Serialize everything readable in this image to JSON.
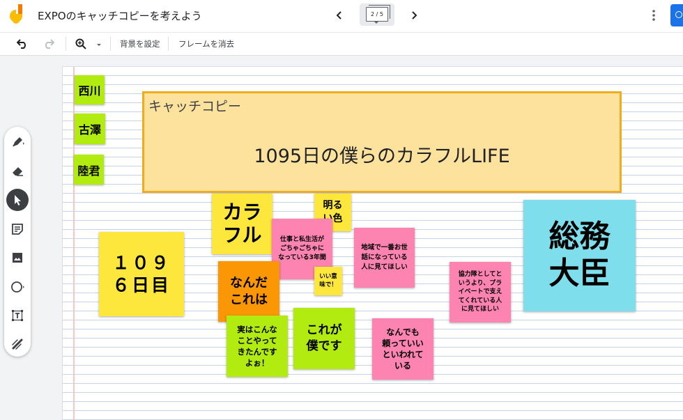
{
  "header": {
    "title": "EXPOのキャッチコピーを考えよう",
    "prev_icon": "chevron-left-icon",
    "next_icon": "chevron-right-icon",
    "frame_counter": "2 / 5",
    "more_icon": "more-vert-icon",
    "share_icon": "person-add-icon"
  },
  "toolbar": {
    "undo_icon": "undo-icon",
    "redo_icon": "redo-icon",
    "zoom_icon": "zoom-icon",
    "set_background_label": "背景を設定",
    "clear_frame_label": "フレームを消去"
  },
  "tools": [
    {
      "name": "pen",
      "icon": "pen-icon"
    },
    {
      "name": "eraser",
      "icon": "eraser-icon"
    },
    {
      "name": "select",
      "icon": "cursor-icon",
      "active": true
    },
    {
      "name": "sticky-note",
      "icon": "sticky-note-icon"
    },
    {
      "name": "image",
      "icon": "image-icon"
    },
    {
      "name": "shape",
      "icon": "circle-icon"
    },
    {
      "name": "text-box",
      "icon": "text-box-icon"
    },
    {
      "name": "laser",
      "icon": "laser-icon"
    }
  ],
  "frame": {
    "label": "キャッチコピー",
    "main_text": "1095日の僕らのカラフルLIFE"
  },
  "notes": [
    {
      "id": "nishikawa",
      "text": "西川",
      "color": "#b2eb10"
    },
    {
      "id": "furusawa",
      "text": "古澤",
      "color": "#b2eb10"
    },
    {
      "id": "rikukun",
      "text": "陸君",
      "color": "#b2eb10"
    },
    {
      "id": "colorful",
      "text": "カラ\nフル",
      "color": "#fde73d"
    },
    {
      "id": "bright",
      "text": "明る\nい色",
      "color": "#fde73d"
    },
    {
      "id": "work-life",
      "text": "仕事と私生活が\nごちゃごちゃに\nなっている3年間",
      "color": "#fd83b0"
    },
    {
      "id": "local",
      "text": "地域で一番お世\n話になっている\n人に見てほしい",
      "color": "#fd83b0"
    },
    {
      "id": "minister",
      "text": "総務\n大臣",
      "color": "#7fdeec"
    },
    {
      "id": "day1096",
      "text": "１０９\n６日目",
      "color": "#fde73d"
    },
    {
      "id": "nandakore",
      "text": "なんだ\nこれは",
      "color": "#fb9605"
    },
    {
      "id": "good-meaning",
      "text": "いい意\n味で！",
      "color": "#fde73d"
    },
    {
      "id": "supporters",
      "text": "協力隊としてと\nいうより、プラ\nイベートで支え\nてくれている人\nに見てほしい",
      "color": "#fd83b0"
    },
    {
      "id": "actually",
      "text": "実はこんな\nことやって\nきたんです\nよぉ！",
      "color": "#b2eb10"
    },
    {
      "id": "this-is-us",
      "text": "これが\n僕です",
      "color": "#b2eb10"
    },
    {
      "id": "rely",
      "text": "なんでも\n頼っていい\nといわれて\nいる",
      "color": "#fd83b0"
    }
  ]
}
